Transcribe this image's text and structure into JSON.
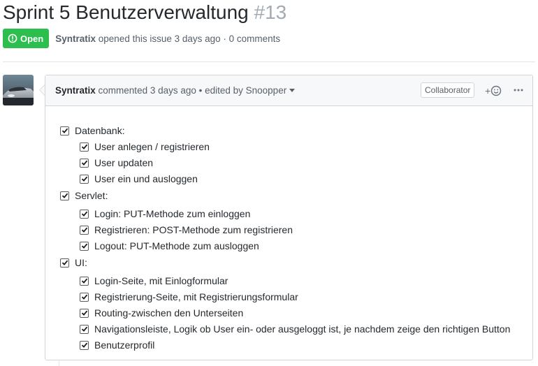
{
  "issue": {
    "title": "Sprint 5 Benutzerverwaltung",
    "number": "#13",
    "state": "Open",
    "author": "Syntratix",
    "opened_text": "opened this issue 3 days ago · 0 comments"
  },
  "comment": {
    "author": "Syntratix",
    "meta_text": "commented 3 days ago • edited by Snoopper",
    "role_badge": "Collaborator",
    "reaction_plus": "+",
    "items": [
      {
        "label": "Datenbank:",
        "level": 0,
        "checked": true
      },
      {
        "label": "User anlegen / registrieren",
        "level": 1,
        "checked": true
      },
      {
        "label": "User updaten",
        "level": 1,
        "checked": true
      },
      {
        "label": "User ein und ausloggen",
        "level": 1,
        "checked": true
      },
      {
        "label": "Servlet:",
        "level": 0,
        "checked": true
      },
      {
        "label": "Login: PUT-Methode zum einloggen",
        "level": 1,
        "checked": true
      },
      {
        "label": "Registrieren: POST-Methode zum registrieren",
        "level": 1,
        "checked": true
      },
      {
        "label": "Logout: PUT-Methode zum ausloggen",
        "level": 1,
        "checked": true
      },
      {
        "label": "UI:",
        "level": 0,
        "checked": true
      },
      {
        "label": "Login-Seite, mit Einlogformular",
        "level": 1,
        "checked": true
      },
      {
        "label": "Registrierung-Seite, mit Registrierungsformular",
        "level": 1,
        "checked": true
      },
      {
        "label": "Routing-zwischen den Unterseiten",
        "level": 1,
        "checked": true
      },
      {
        "label": "Navigationsleiste, Logik ob User ein- oder ausgeloggt ist, je nachdem zeige den richtigen Button",
        "level": 1,
        "checked": true
      },
      {
        "label": "Benutzerprofil",
        "level": 1,
        "checked": true
      }
    ]
  },
  "colors": {
    "open_badge": "#2cbe4e",
    "border": "#d1d5da",
    "header_bg": "#f6f8fa"
  },
  "icons": {
    "state": "issue-opened-icon",
    "reaction": "smiley-icon",
    "more": "kebab-horizontal-icon"
  }
}
